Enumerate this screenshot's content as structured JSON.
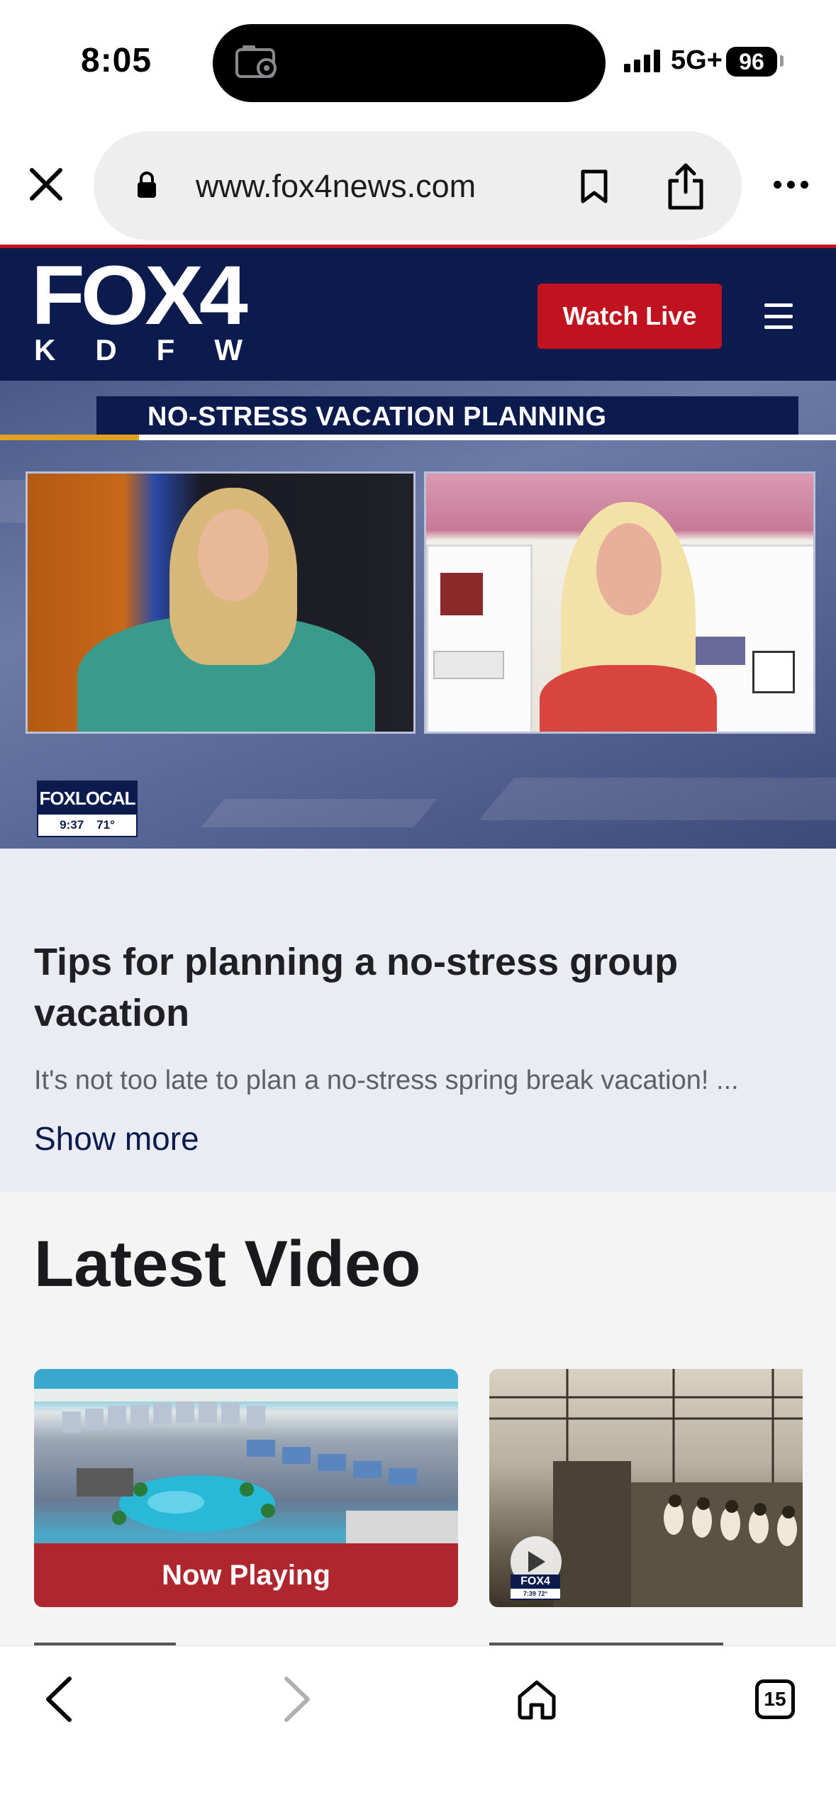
{
  "status_bar": {
    "time": "8:05",
    "network": "5G+",
    "battery": "96"
  },
  "browser": {
    "url": "www.fox4news.com",
    "icons": [
      "close-icon",
      "lock-icon",
      "bookmark-icon",
      "share-icon",
      "more-icon"
    ]
  },
  "site_header": {
    "logo_main": "FOX4",
    "logo_sub": "KDFW",
    "watch_live_label": "Watch Live",
    "brand_navy": "#0c1b4d",
    "brand_red": "#c1121f"
  },
  "video": {
    "banner_text": "NO-STRESS VACATION PLANNING",
    "bug_label": "FOXLOCAL",
    "bug_time": "9:37",
    "bug_temp": "71°"
  },
  "article": {
    "title": "Tips for planning a no-stress group vacation",
    "description": "It's not too late to plan a no-stress spring break vacation! ...",
    "show_more_label": "Show more"
  },
  "latest": {
    "heading": "Latest Video",
    "now_playing_label": "Now Playing",
    "card2_bug": "FOX4",
    "card2_bug_time": "7:39",
    "card2_bug_temp": "72°"
  },
  "toolbar": {
    "tabs_count": "15",
    "icons": [
      "back-icon",
      "forward-icon",
      "home-icon",
      "tabs-icon"
    ]
  }
}
